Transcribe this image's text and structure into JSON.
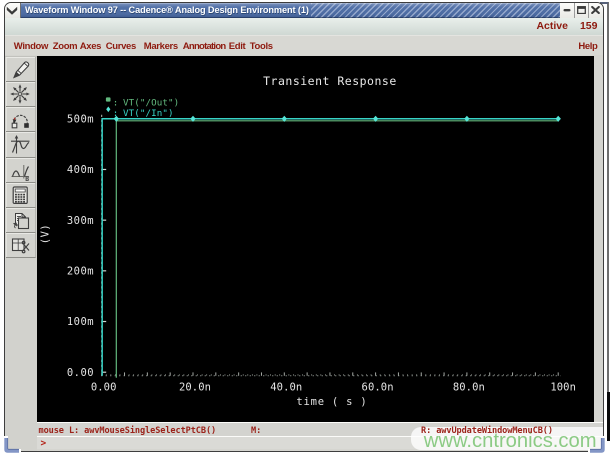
{
  "window": {
    "title": "Waveform Window 97 -- Cadence® Analog Design Environment (1)",
    "controls": {
      "menu_icon": "chevron-down",
      "minimize_icon": "minimize",
      "maximize_icon": "maximize",
      "close_icon": "close"
    }
  },
  "active_indicator": {
    "label": "Active",
    "value": "159"
  },
  "menubar": {
    "items": [
      "Window",
      "Zoom",
      "Axes",
      "Curves",
      "Markers",
      "Annotation",
      "Edit",
      "Tools"
    ],
    "help": "Help"
  },
  "toolbar": {
    "buttons": [
      "pen",
      "zoom-fit",
      "trace-arc",
      "strip-chart",
      "compare-waveforms",
      "calculator",
      "copy-window",
      "cut-window"
    ]
  },
  "statusbar": {
    "left": "mouse L: awvMouseSingleSelectPtCB()",
    "middle": "M:",
    "right": "R: awvUpdateWindowMenuCB()"
  },
  "command_row": {
    "prompt": ">"
  },
  "watermark": {
    "text": "www.cntronics.com"
  },
  "colors": {
    "titlebar_blue": "#5472a8",
    "menu_text": "#8e1a0f",
    "plot_background": "#000000",
    "plot_text": "#e6e6e6",
    "series_out_green": "#5bb277",
    "series_in_cyan": "#38d3c6",
    "marker_cyan": "#55e6d8",
    "watermark_green": "#7cc476"
  },
  "chart_data": {
    "type": "line",
    "title": "Transient Response",
    "xlabel": "time ( s )",
    "ylabel": "(V)",
    "x_unit": "ns",
    "xlim": [
      0,
      100
    ],
    "ylim": [
      0,
      0.5
    ],
    "grid": false,
    "legend_position": "top-left",
    "x_major_ticks": [
      {
        "v": 0,
        "label": "0.00"
      },
      {
        "v": 20,
        "label": "20.0n"
      },
      {
        "v": 40,
        "label": "40.0n"
      },
      {
        "v": 60,
        "label": "60.0n"
      },
      {
        "v": 80,
        "label": "80.0n"
      },
      {
        "v": 100,
        "label": "100n"
      }
    ],
    "x_minor_step": 1,
    "x_mid_step": 5,
    "y_major_ticks": [
      {
        "v": 0.5,
        "label": "500m"
      },
      {
        "v": 0.4,
        "label": "400m"
      },
      {
        "v": 0.3,
        "label": "300m"
      },
      {
        "v": 0.2,
        "label": "200m"
      },
      {
        "v": 0.1,
        "label": "100m"
      },
      {
        "v": 0.0,
        "label": "0.00"
      }
    ],
    "series": [
      {
        "name": "VT(\"/Out\")",
        "color": "#62b87e",
        "legend_marker": "square",
        "points": [
          [
            3.2,
            0
          ],
          [
            3.2,
            0.5
          ],
          [
            100,
            0.5
          ]
        ]
      },
      {
        "name": "VT(\"/In\")",
        "color": "#38d3c6",
        "legend_marker": "diamond",
        "marker_color": "#55e6d8",
        "points": [
          [
            0.1,
            0
          ],
          [
            0.1,
            0.5
          ],
          [
            100,
            0.5
          ]
        ],
        "marker_points_x": [
          3.2,
          20,
          40,
          60,
          80,
          100
        ]
      }
    ]
  }
}
